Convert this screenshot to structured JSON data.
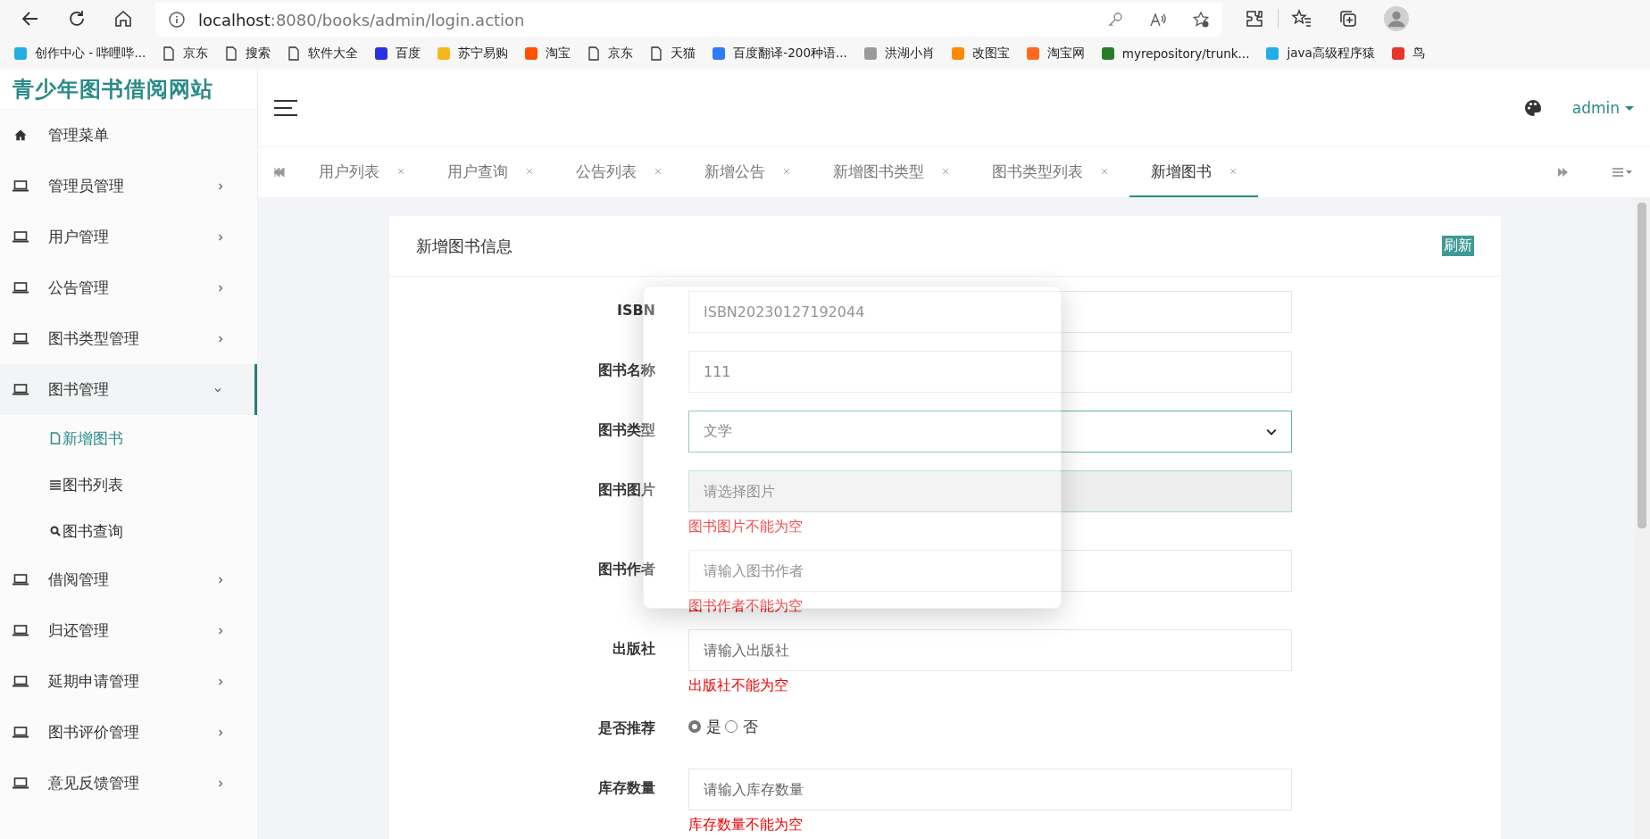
{
  "browser": {
    "url_host": "localhost",
    "url_path": ":8080/books/admin/login.action"
  },
  "bookmarks": [
    {
      "label": "创作中心 - 哔哩哔...",
      "kind": "favicon",
      "color": "#23ade5"
    },
    {
      "label": "京东",
      "kind": "page"
    },
    {
      "label": "搜索",
      "kind": "page"
    },
    {
      "label": "软件大全",
      "kind": "page"
    },
    {
      "label": "百度",
      "kind": "favicon",
      "color": "#2932e1"
    },
    {
      "label": "苏宁易购",
      "kind": "favicon",
      "color": "#f5b81c"
    },
    {
      "label": "淘宝",
      "kind": "favicon",
      "color": "#ff5000"
    },
    {
      "label": "京东",
      "kind": "page"
    },
    {
      "label": "天猫",
      "kind": "page"
    },
    {
      "label": "百度翻译-200种语...",
      "kind": "favicon",
      "color": "#2f7cf6"
    },
    {
      "label": "洪湖小肖",
      "kind": "favicon",
      "color": "#9a9a9a"
    },
    {
      "label": "改图宝",
      "kind": "favicon",
      "color": "#ff8a00"
    },
    {
      "label": "淘宝网",
      "kind": "favicon",
      "color": "#ff6a1f"
    },
    {
      "label": "myrepository/trunk...",
      "kind": "favicon",
      "color": "#2a7a2a"
    },
    {
      "label": "java高级程序猿",
      "kind": "favicon",
      "color": "#23ade5"
    },
    {
      "label": "鸟",
      "kind": "favicon",
      "color": "#e8352c"
    }
  ],
  "site_title": "青少年图书借阅网站",
  "sidebar": {
    "items": [
      {
        "label": "管理菜单",
        "kind": "header"
      },
      {
        "label": "管理员管理",
        "kind": "menu",
        "expanded": false
      },
      {
        "label": "用户管理",
        "kind": "menu",
        "expanded": false
      },
      {
        "label": "公告管理",
        "kind": "menu",
        "expanded": false
      },
      {
        "label": "图书类型管理",
        "kind": "menu",
        "expanded": false
      },
      {
        "label": "图书管理",
        "kind": "menu",
        "expanded": true,
        "children": [
          {
            "label": "新增图书",
            "kind": "file",
            "selected": true
          },
          {
            "label": "图书列表",
            "kind": "list",
            "selected": false
          },
          {
            "label": "图书查询",
            "kind": "search",
            "selected": false
          }
        ]
      },
      {
        "label": "借阅管理",
        "kind": "menu",
        "expanded": false
      },
      {
        "label": "归还管理",
        "kind": "menu",
        "expanded": false
      },
      {
        "label": "延期申请管理",
        "kind": "menu",
        "expanded": false
      },
      {
        "label": "图书评价管理",
        "kind": "menu",
        "expanded": false
      },
      {
        "label": "意见反馈管理",
        "kind": "menu",
        "expanded": false
      }
    ]
  },
  "header": {
    "user": "admin"
  },
  "tabs": [
    {
      "label": "用户列表",
      "selected": false
    },
    {
      "label": "用户查询",
      "selected": false
    },
    {
      "label": "公告列表",
      "selected": false
    },
    {
      "label": "新增公告",
      "selected": false
    },
    {
      "label": "新增图书类型",
      "selected": false
    },
    {
      "label": "图书类型列表",
      "selected": false
    },
    {
      "label": "新增图书",
      "selected": true
    }
  ],
  "card": {
    "title": "新增图书信息",
    "refresh": "刷新"
  },
  "form": [
    {
      "label": "ISBN",
      "kind": "readonly",
      "value": "ISBN20230127192044"
    },
    {
      "label": "图书名称",
      "kind": "input",
      "value": "111"
    },
    {
      "label": "图书类型",
      "kind": "select",
      "value": "文学"
    },
    {
      "label": "图书图片",
      "kind": "file",
      "placeholder": "请选择图片",
      "error": "图书图片不能为空"
    },
    {
      "label": "图书作者",
      "kind": "input",
      "placeholder": "请输入图书作者",
      "error": "图书作者不能为空"
    },
    {
      "label": "出版社",
      "kind": "input",
      "placeholder": "请输入出版社",
      "error": "出版社不能为空"
    },
    {
      "label": "是否推荐",
      "kind": "radio",
      "options": [
        {
          "label": "是",
          "selected": true
        },
        {
          "label": "否",
          "selected": false
        }
      ]
    },
    {
      "label": "库存数量",
      "kind": "input",
      "placeholder": "请输入库存数量",
      "error": "库存数量不能为空"
    }
  ]
}
